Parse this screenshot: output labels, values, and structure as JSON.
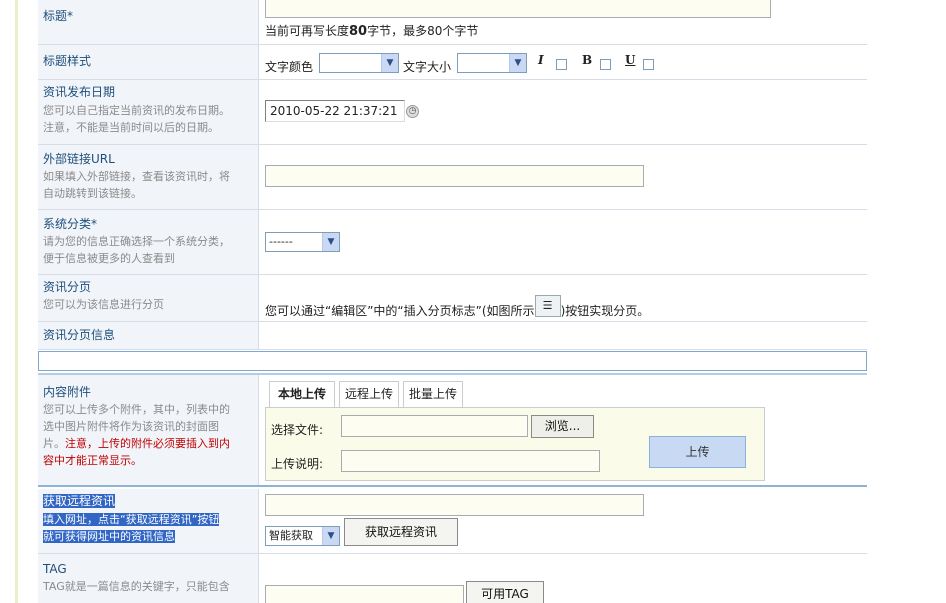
{
  "title_row": {
    "label": "标题*",
    "hint": "当前可再写长度",
    "count": "80",
    "hint2": "字节，最多80个字节"
  },
  "style_row": {
    "label": "标题样式",
    "color_label": "文字颜色",
    "size_label": "文字大小",
    "italic": "I",
    "bold": "B",
    "underline": "U"
  },
  "date_row": {
    "label": "资讯发布日期",
    "desc1": "您可以自己指定当前资讯的发布日期。",
    "desc2": "注意，不能是当前时间以后的日期。",
    "value": "2010-05-22 21:37:21"
  },
  "url_row": {
    "label": "外部链接URL",
    "desc1": "如果填入外部链接，查看该资讯时，将",
    "desc2": "自动跳转到该链接。"
  },
  "cat_row": {
    "label": "系统分类*",
    "desc1": "请为您的信息正确选择一个系统分类，",
    "desc2": "便于信息被更多的人查看到",
    "selected": "------"
  },
  "page_row": {
    "label": "资讯分页",
    "desc": "您可以为该信息进行分页",
    "text1": "您可以通过“编辑区”中的“插入分页标志”(如图所示",
    "text2": ")按钮实现分页。"
  },
  "pageinfo_row": {
    "label": "资讯分页信息"
  },
  "attach_row": {
    "label": "内容附件",
    "desc1": "您可以上传多个附件，其中，列表中的",
    "desc2": "选中图片附件将作为该资讯的封面图",
    "desc3": "片。",
    "warn1": "注意，上传的附件必须要插入到内",
    "warn2": "容中才能正常显示。",
    "tabs": [
      "本地上传",
      "远程上传",
      "批量上传"
    ],
    "file_label": "选择文件:",
    "browse": "浏览...",
    "note_label": "上传说明:",
    "upload": "上传"
  },
  "remote_row": {
    "label": "获取远程资讯",
    "desc1": "填入网址，点击“获取远程资讯”按钮",
    "desc2": "就可获得网址中的资讯信息",
    "mode": "智能获取",
    "button": "获取远程资讯"
  },
  "tag_row": {
    "label": "TAG",
    "desc1": "TAG就是一篇信息的关键字，只能包含",
    "button": "可用TAG"
  }
}
